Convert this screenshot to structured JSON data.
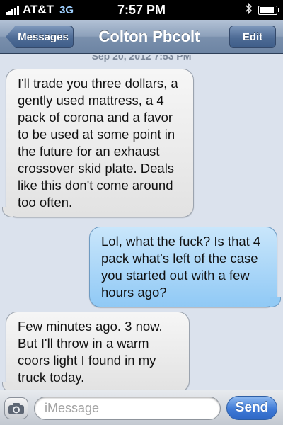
{
  "status_bar": {
    "carrier": "AT&T",
    "network": "3G",
    "time": "7:57 PM",
    "bluetooth_icon": "bluetooth-icon",
    "battery_level": 0.85
  },
  "nav": {
    "back_label": "Messages",
    "title": "Colton Pbcolt",
    "edit_label": "Edit"
  },
  "conversation": {
    "timestamp": "Sep 20, 2012 7:53 PM",
    "messages": [
      {
        "direction": "received",
        "text": "I'll trade you three dollars, a gently used mattress, a 4 pack of corona and a favor to be used at some point in the future for an exhaust crossover skid plate. Deals like this don't come around too often."
      },
      {
        "direction": "sent",
        "text": "Lol, what the fuck? Is that 4 pack what's left of the case you started out with a few hours ago?"
      },
      {
        "direction": "received",
        "text": "Few minutes ago. 3 now. But I'll throw in a warm coors light I found in my truck today."
      }
    ]
  },
  "composer": {
    "placeholder": "iMessage",
    "value": "",
    "send_label": "Send",
    "camera_icon": "camera-icon"
  },
  "colors": {
    "nav_bar": "#7a90ad",
    "sent_bubble": "#90c9f5",
    "received_bubble": "#e2e2e2",
    "send_button": "#3f7ad6",
    "background": "#dbe2ed"
  }
}
